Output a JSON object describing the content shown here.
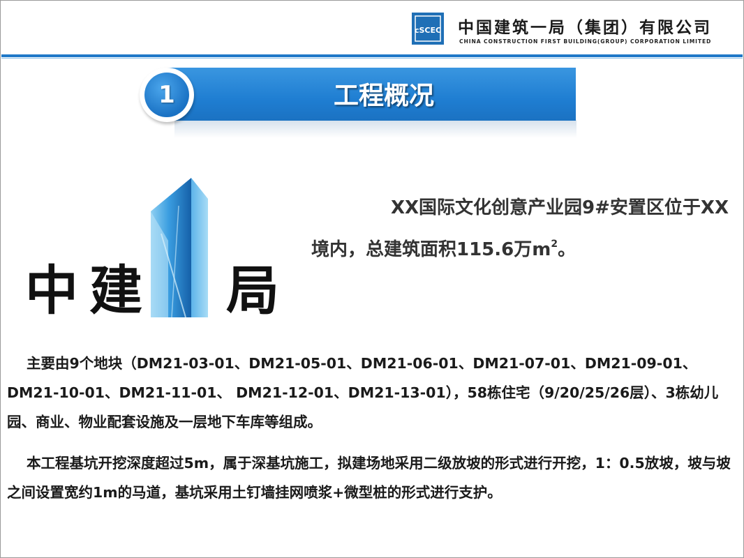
{
  "header": {
    "company_cn": "中国建筑一局（集团）有限公司",
    "company_en": "CHINA CONSTRUCTION FIRST BUILDING(GROUP) CORPORATION LIMITED",
    "logo_icon": "cscec-logo-icon",
    "accent_color": "#1f78c8"
  },
  "section": {
    "number": "1",
    "title": "工程概况"
  },
  "logo_graphic": {
    "icon": "cscec-first-bureau-logo",
    "chars": [
      "中",
      "建",
      "局"
    ]
  },
  "intro": {
    "line1": "XX国际文化创意产业园9#安置区位于XX",
    "line2": "境内，总建筑面积115.6万m",
    "sup": "2",
    "end": "。"
  },
  "paragraphs": [
    "主要由9个地块（DM21-03-01、DM21-05-01、DM21-06-01、DM21-07-01、DM21-09-01、DM21-10-01、DM21-11-01、 DM21-12-01、DM21-13-01），58栋住宅（9/20/25/26层）、3栋幼儿园、商业、物业配套设施及一层地下车库等组成。",
    "本工程基坑开挖深度超过5m，属于深基坑施工，拟建场地采用二级放坡的形式进行开挖，1：0.5放坡，坡与坡之间设置宽约1m的马道，基坑采用土钉墙挂网喷浆+微型桩的形式进行支护。"
  ]
}
